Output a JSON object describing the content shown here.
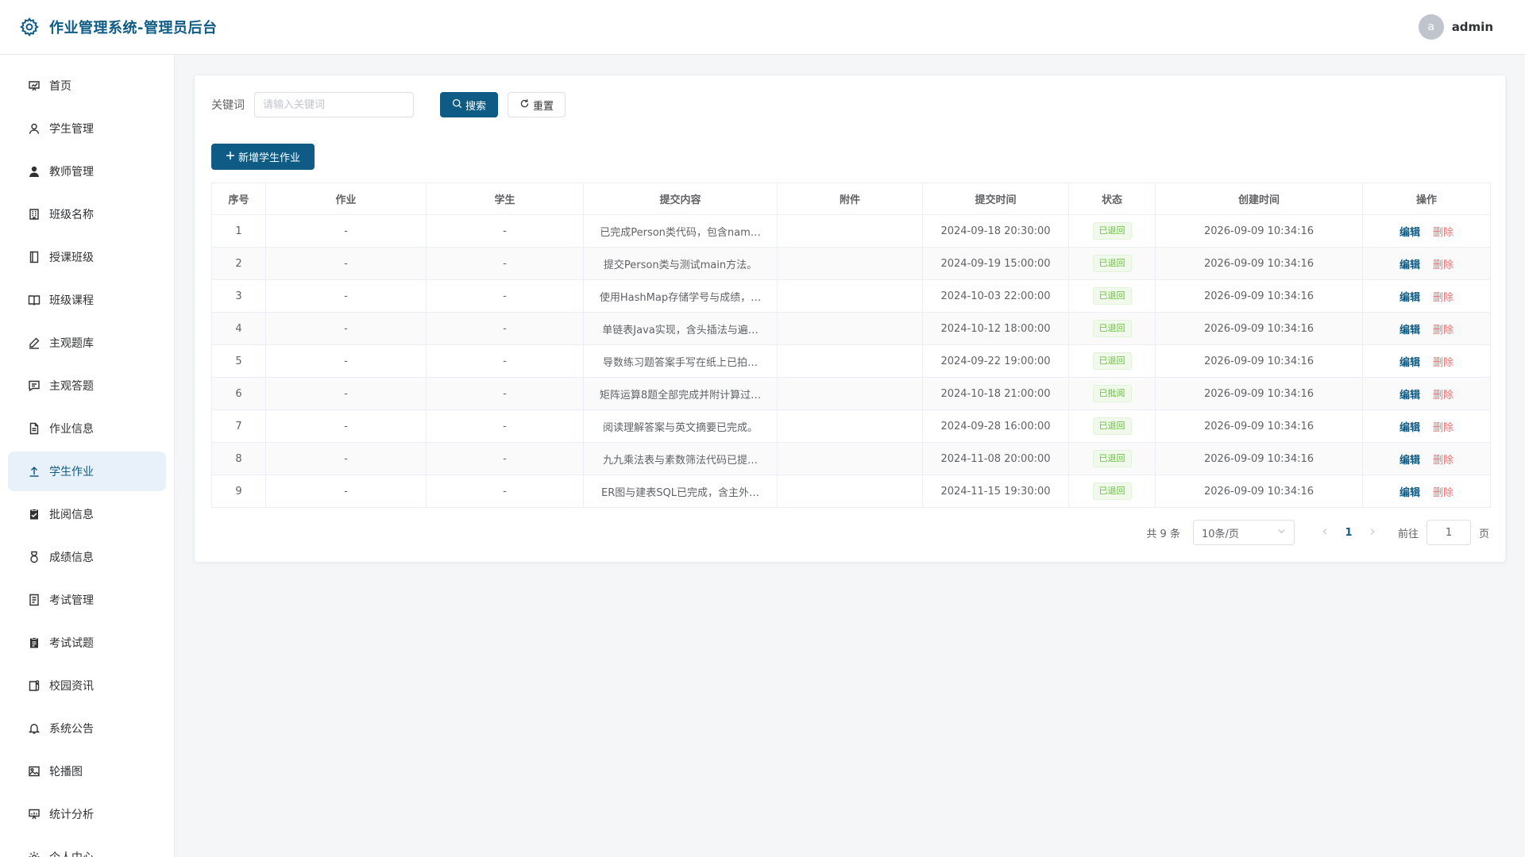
{
  "app": {
    "title": "作业管理系统-管理员后台",
    "user": {
      "avatar_letter": "a",
      "name": "admin"
    }
  },
  "sidebar": {
    "items": [
      {
        "label": "首页",
        "icon": "chart-board-icon",
        "active": false
      },
      {
        "label": "学生管理",
        "icon": "user-outline-icon",
        "active": false
      },
      {
        "label": "教师管理",
        "icon": "user-filled-icon",
        "active": false
      },
      {
        "label": "班级名称",
        "icon": "building-icon",
        "active": false
      },
      {
        "label": "授课班级",
        "icon": "notebook-icon",
        "active": false
      },
      {
        "label": "班级课程",
        "icon": "book-open-icon",
        "active": false
      },
      {
        "label": "主观题库",
        "icon": "pen-icon",
        "active": false
      },
      {
        "label": "主观答题",
        "icon": "message-icon",
        "active": false
      },
      {
        "label": "作业信息",
        "icon": "document-icon",
        "active": false
      },
      {
        "label": "学生作业",
        "icon": "upload-icon",
        "active": true
      },
      {
        "label": "批阅信息",
        "icon": "clipboard-check-icon",
        "active": false
      },
      {
        "label": "成绩信息",
        "icon": "medal-icon",
        "active": false
      },
      {
        "label": "考试管理",
        "icon": "list-doc-icon",
        "active": false
      },
      {
        "label": "考试试题",
        "icon": "clipboard-filled-icon",
        "active": false
      },
      {
        "label": "校园资讯",
        "icon": "news-icon",
        "active": false
      },
      {
        "label": "系统公告",
        "icon": "bell-icon",
        "active": false
      },
      {
        "label": "轮播图",
        "icon": "picture-icon",
        "active": false
      },
      {
        "label": "统计分析",
        "icon": "stats-board-icon",
        "active": false
      },
      {
        "label": "个人中心",
        "icon": "setting-icon",
        "active": false
      }
    ]
  },
  "search": {
    "label": "关键词",
    "placeholder": "请输入关键词",
    "search_label": "搜索",
    "reset_label": "重置"
  },
  "toolbar": {
    "add_label": "新增学生作业"
  },
  "table": {
    "columns": [
      "序号",
      "作业",
      "学生",
      "提交内容",
      "附件",
      "提交时间",
      "状态",
      "创建时间",
      "操作"
    ],
    "actions": {
      "edit": "编辑",
      "delete": "删除"
    },
    "rows": [
      {
        "index": "1",
        "homework": "-",
        "student": "-",
        "content": "已完成Person类代码，包含nam…",
        "attachment": "",
        "submit_time": "2024-09-18 20:30:00",
        "status": "已退回",
        "created": "2026-09-09 10:34:16"
      },
      {
        "index": "2",
        "homework": "-",
        "student": "-",
        "content": "提交Person类与测试main方法。",
        "attachment": "",
        "submit_time": "2024-09-19 15:00:00",
        "status": "已退回",
        "created": "2026-09-09 10:34:16"
      },
      {
        "index": "3",
        "homework": "-",
        "student": "-",
        "content": "使用HashMap存储学号与成绩，…",
        "attachment": "",
        "submit_time": "2024-10-03 22:00:00",
        "status": "已退回",
        "created": "2026-09-09 10:34:16"
      },
      {
        "index": "4",
        "homework": "-",
        "student": "-",
        "content": "单链表Java实现，含头插法与遍…",
        "attachment": "",
        "submit_time": "2024-10-12 18:00:00",
        "status": "已退回",
        "created": "2026-09-09 10:34:16"
      },
      {
        "index": "5",
        "homework": "-",
        "student": "-",
        "content": "导数练习题答案手写在纸上已拍…",
        "attachment": "",
        "submit_time": "2024-09-22 19:00:00",
        "status": "已退回",
        "created": "2026-09-09 10:34:16"
      },
      {
        "index": "6",
        "homework": "-",
        "student": "-",
        "content": "矩阵运算8题全部完成并附计算过…",
        "attachment": "",
        "submit_time": "2024-10-18 21:00:00",
        "status": "已批阅",
        "created": "2026-09-09 10:34:16"
      },
      {
        "index": "7",
        "homework": "-",
        "student": "-",
        "content": "阅读理解答案与英文摘要已完成。",
        "attachment": "",
        "submit_time": "2024-09-28 16:00:00",
        "status": "已退回",
        "created": "2026-09-09 10:34:16"
      },
      {
        "index": "8",
        "homework": "-",
        "student": "-",
        "content": "九九乘法表与素数筛法代码已提…",
        "attachment": "",
        "submit_time": "2024-11-08 20:00:00",
        "status": "已退回",
        "created": "2026-09-09 10:34:16"
      },
      {
        "index": "9",
        "homework": "-",
        "student": "-",
        "content": "ER图与建表SQL已完成，含主外…",
        "attachment": "",
        "submit_time": "2024-11-15 19:30:00",
        "status": "已退回",
        "created": "2026-09-09 10:34:16"
      }
    ]
  },
  "pagination": {
    "total": "共 9 条",
    "page_size": "10条/页",
    "current_page": "1",
    "goto_label": "前往",
    "goto_value": "1",
    "page_suffix": "页"
  },
  "colors": {
    "brand": "#0e5c86",
    "active_bg": "#e8f1fa",
    "danger": "#f56c6c",
    "success": "#67c23a"
  }
}
